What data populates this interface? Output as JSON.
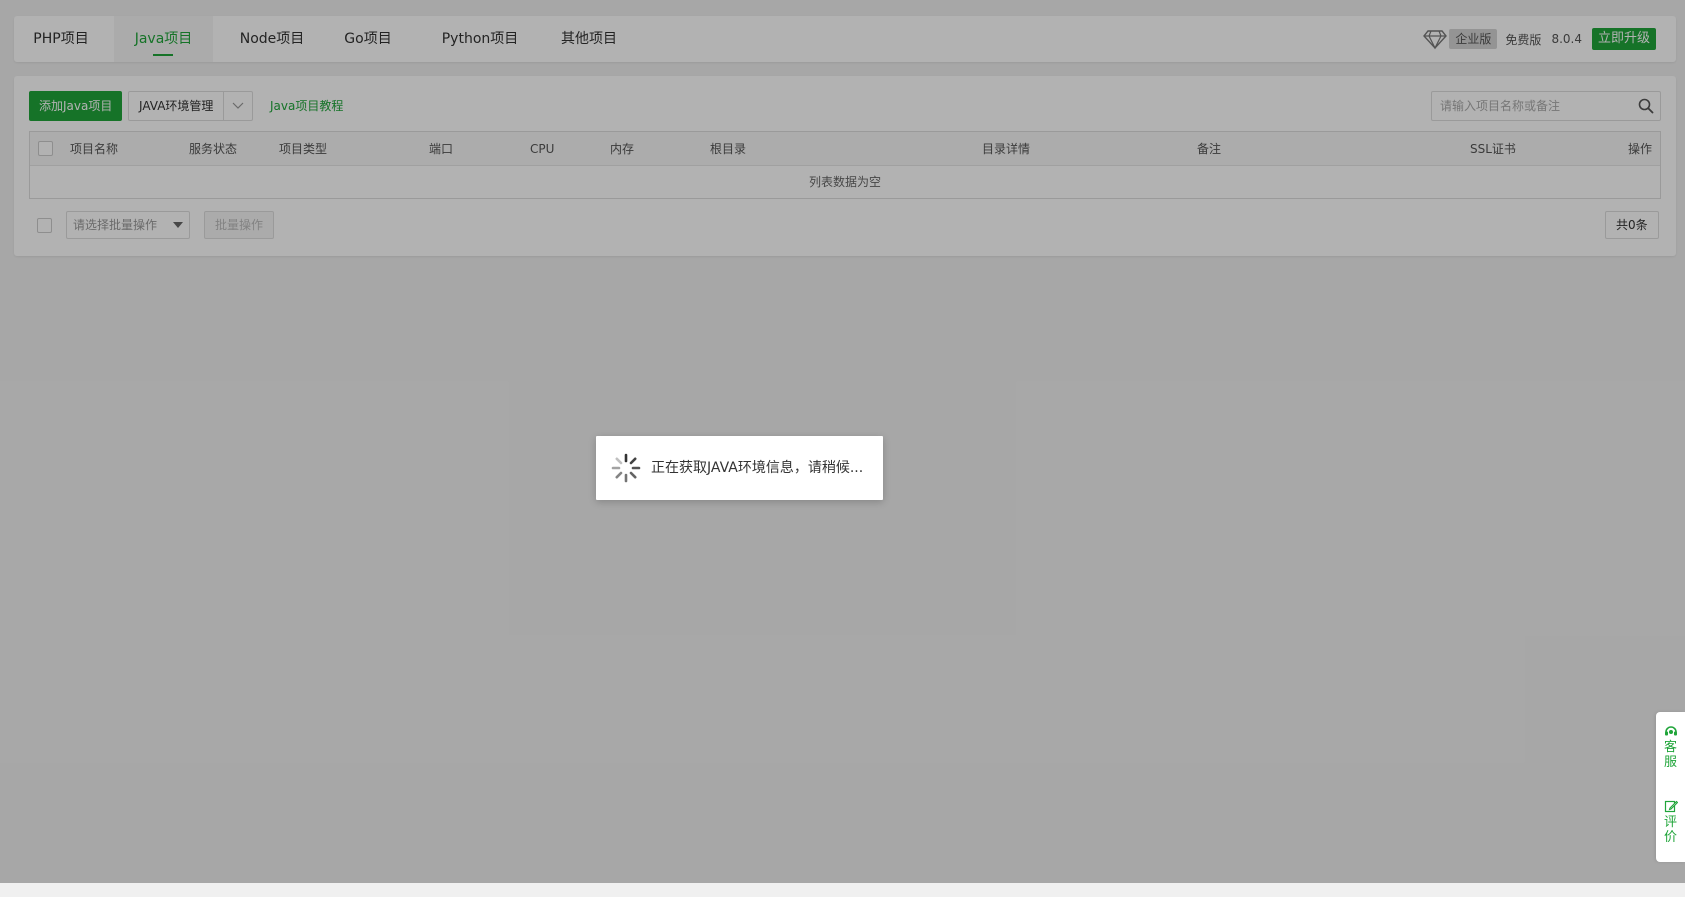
{
  "tabs": [
    {
      "label": "PHP项目",
      "active": false
    },
    {
      "label": "Java项目",
      "active": true
    },
    {
      "label": "Node项目",
      "active": false
    },
    {
      "label": "Go项目",
      "active": false
    },
    {
      "label": "Python项目",
      "active": false
    },
    {
      "label": "其他项目",
      "active": false
    }
  ],
  "header_right": {
    "enterprise_label": "企业版",
    "free_label": "免费版",
    "version": "8.0.4",
    "upgrade_label": "立即升级"
  },
  "toolbar": {
    "add_label": "添加Java项目",
    "env_label": "JAVA环境管理",
    "tutorial_label": "Java项目教程",
    "search_placeholder": "请输入项目名称或备注"
  },
  "table": {
    "columns": [
      "项目名称",
      "服务状态",
      "项目类型",
      "端口",
      "CPU",
      "内存",
      "根目录",
      "目录详情",
      "备注",
      "SSL证书",
      "操作"
    ],
    "empty_text": "列表数据为空"
  },
  "footer": {
    "batch_placeholder": "请选择批量操作",
    "batch_button": "批量操作",
    "total": "共0条"
  },
  "loading": {
    "text": "正在获取JAVA环境信息，请稍候..."
  },
  "side_bar": {
    "service": [
      "客",
      "服"
    ],
    "review": [
      "评",
      "价"
    ]
  },
  "colors": {
    "accent": "#20a53a",
    "overlay": "rgba(0,0,0,0.3)"
  }
}
